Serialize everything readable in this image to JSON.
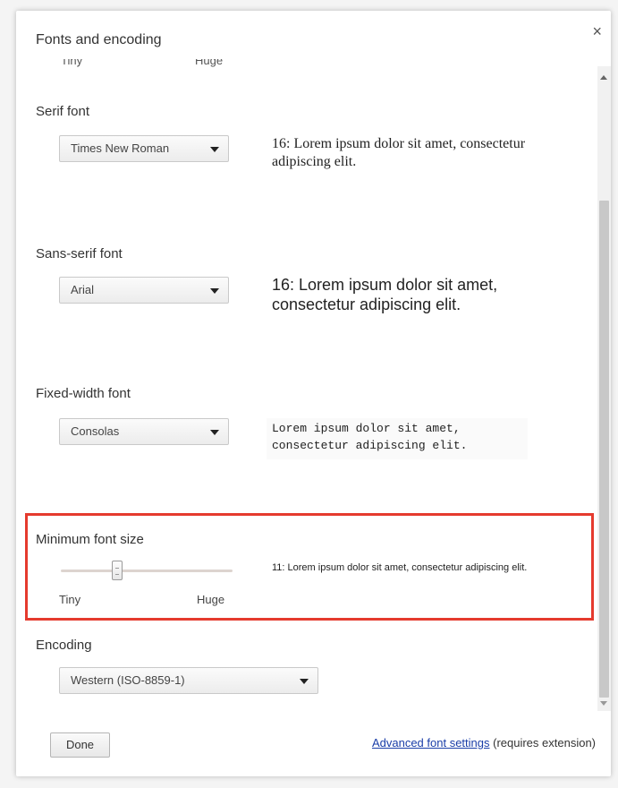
{
  "dialog": {
    "title": "Fonts and encoding",
    "close_glyph": "×"
  },
  "top_cut": {
    "min_label": "Tiny",
    "max_label": "Huge"
  },
  "serif": {
    "label": "Serif font",
    "selected": "Times New Roman",
    "sample": "16: Lorem ipsum dolor sit amet, consectetur adipiscing elit."
  },
  "sans": {
    "label": "Sans-serif font",
    "selected": "Arial",
    "sample": "16: Lorem ipsum dolor sit amet, consectetur adipiscing elit."
  },
  "fixed": {
    "label": "Fixed-width font",
    "selected": "Consolas",
    "sample": "Lorem ipsum dolor sit amet, consectetur adipiscing elit."
  },
  "min_size": {
    "label": "Minimum font size",
    "min_label": "Tiny",
    "max_label": "Huge",
    "value_fraction": 0.33,
    "sample": "11: Lorem ipsum dolor sit amet, consectetur adipiscing elit."
  },
  "encoding": {
    "label": "Encoding",
    "selected": "Western (ISO-8859-1)"
  },
  "footer": {
    "done_label": "Done",
    "advanced_link": "Advanced font settings",
    "requires_note": " (requires extension)"
  },
  "colors": {
    "highlight": "#e53a2e",
    "link": "#1a3ea8"
  }
}
